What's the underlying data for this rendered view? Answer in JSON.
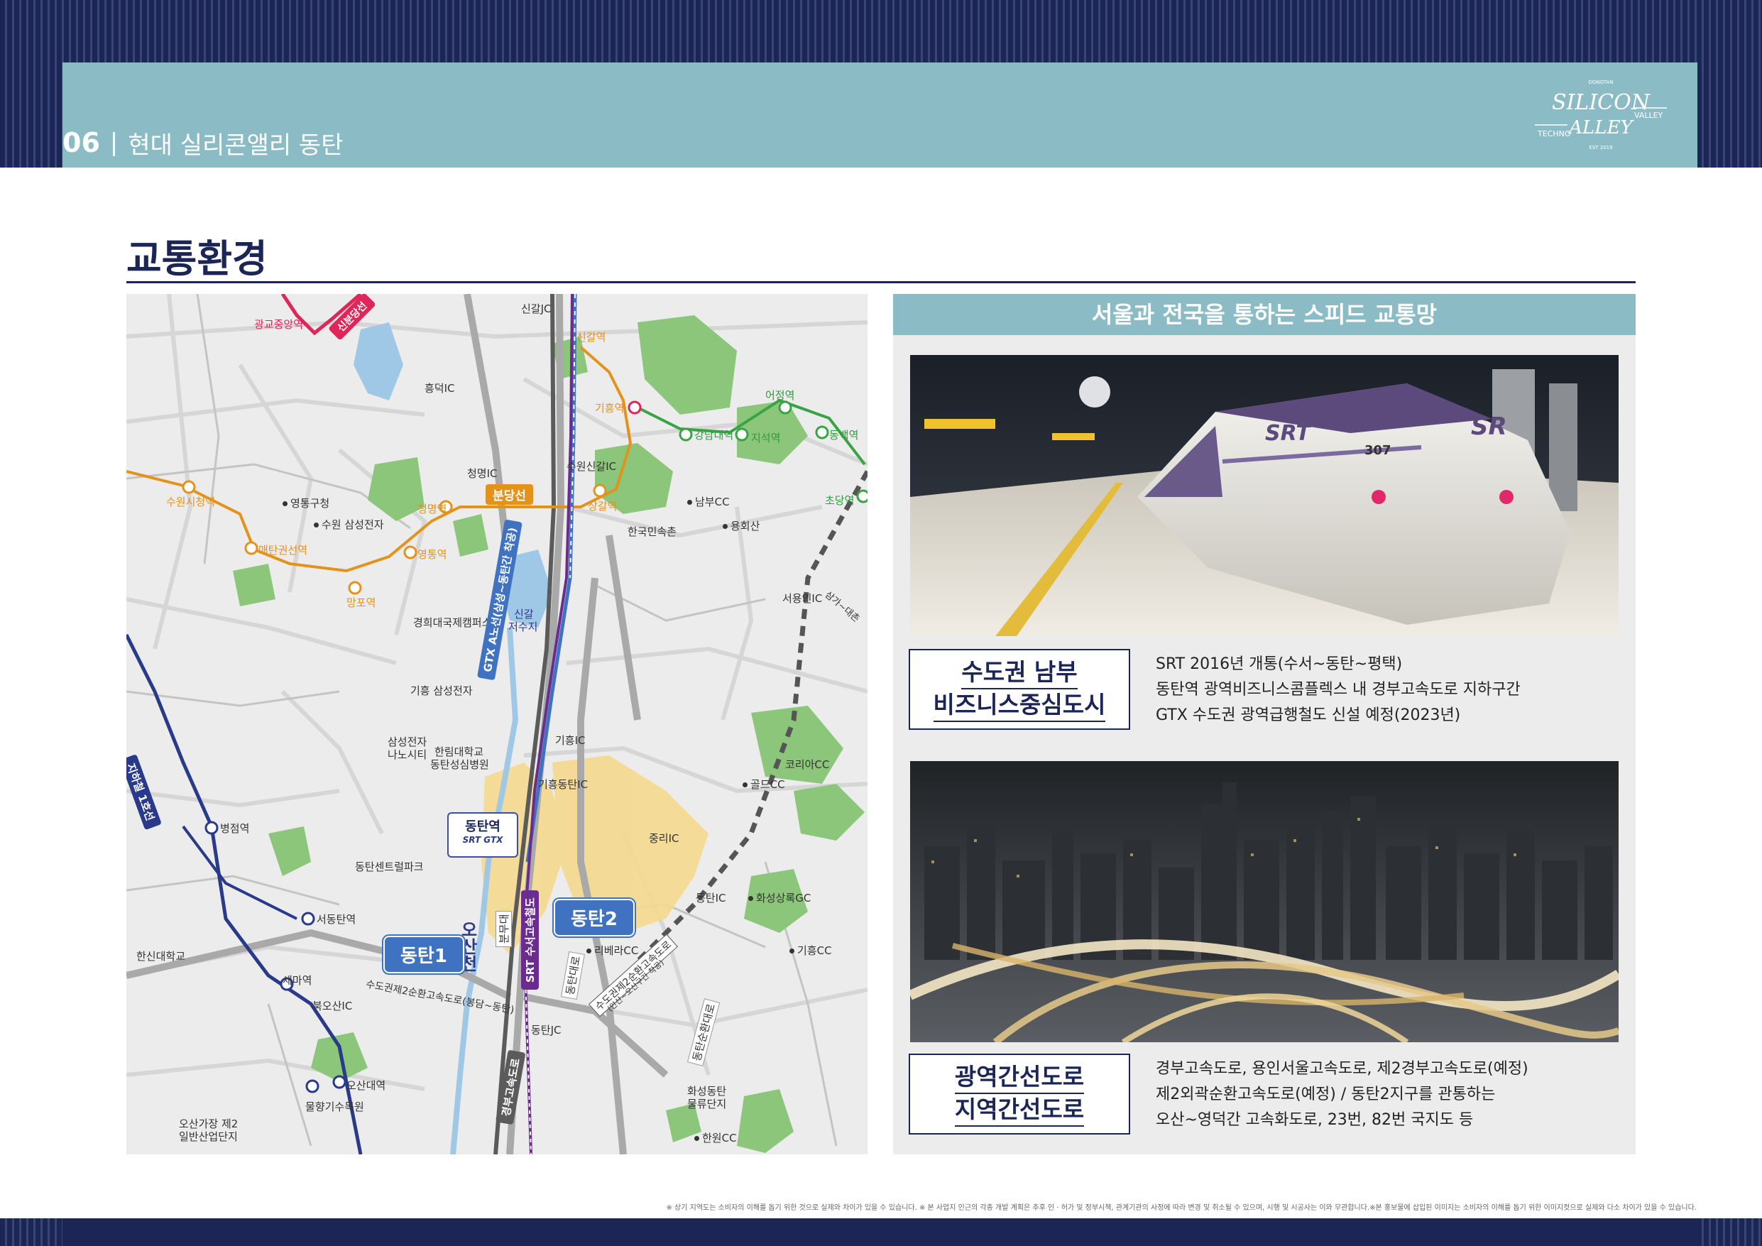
{
  "header": {
    "section_number": "06",
    "divider": "|",
    "section_title": "현대 실리콘앨리 동탄",
    "logo": {
      "top": "DONGTAN",
      "line1": "SILICON",
      "left": "TECHNO",
      "right": "VALLEY",
      "line2": "ALLEY",
      "bottom": "EST 2019"
    }
  },
  "page_title": "교통환경",
  "map": {
    "labels": {
      "gwanggyo_jungang": "광교중앙역",
      "sinbundang": "신분당선",
      "singal_jc": "신갈JC",
      "singal_station": "신갈역",
      "heungdeok_ic": "흥덕IC",
      "giheung_station": "기흥역",
      "eojeong": "어정역",
      "gangnam_univ": "강남대역",
      "jiseok": "지석역",
      "dongbaek": "동백역",
      "suwon_singal_ic": "수원신갈IC",
      "cheongmyeong_ic": "청명IC",
      "bundang_line": "분당선",
      "cheongmyeong_station": "청명역",
      "sanggal": "상갈역",
      "nambu_cc": "남부CC",
      "chodang": "초당역",
      "suwon_city_hall": "수원시청역",
      "yeongtong_gu": "영통구청",
      "suwon_samsung": "수원 삼성전자",
      "korean_folk_village": "한국민속촌",
      "yonghoesan": "용회산",
      "maetan": "매탄권선역",
      "yeongtong": "영통역",
      "mangpo": "망포역",
      "seoyongin_ic": "서용인IC",
      "samga_daechon": "삼가~대촌",
      "kyunghee": "경희대국제캠퍼스",
      "singal_reservoir_1": "신갈",
      "singal_reservoir_2": "저수지",
      "giheung_samsung": "기흥 삼성전자",
      "samsung_nanocity_1": "삼성전자",
      "samsung_nanocity_2": "나노시티",
      "hallym_1": "한림대학교",
      "hallym_2": "동탄성심병원",
      "giheung_ic": "기흥IC",
      "giheung_dongtan_ic": "기흥동탄IC",
      "golf_cc": "골드CC",
      "korea_cc": "코리아CC",
      "jungni_ic": "중리IC",
      "byeongjeom": "병점역",
      "dongtan_central_park": "동탄센트럴파크",
      "dongtan_station": "동탄역",
      "srt_gtx": "SRT GTX",
      "dongtan_ic": "동탄IC",
      "hwaseong_sangrok_gc": "화성상록GC",
      "seodongtan": "서동탄역",
      "dongtan2": "동탄2",
      "dongtan1": "동탄1",
      "riviera_cc": "리베라CC",
      "giheung_cc": "기흥CC",
      "hanshin_univ": "한신대학교",
      "sema": "세마역",
      "buk_osan_ic": "북오산IC",
      "capital_ring2": "수도권제2순환고속도로(봉담~동탄)",
      "dongtan_jc": "동탄JC",
      "capital_ring2_b": "수도권제2순환고속도로",
      "capital_ring2_c": "(안산~오산구간 착공)",
      "osan_univ": "오산대역",
      "hwaseong_logistics_1": "화성동탄",
      "hwaseong_logistics_2": "물류단지",
      "mulhyang_park": "물향기수목원",
      "osan_gajang_1": "오산가장 제2",
      "osan_gajang_2": "일반산업단지",
      "hanwon_cc": "한원CC",
      "gtx": "GTX A노선(삼성~동탄간 착공)",
      "srt": "SRT 수서고속철도",
      "line1_subway": "지하철 1호선",
      "osancheon": "오산천",
      "bunmyeongdae": "분무대",
      "gyeongbu": "경부고속도로",
      "dongtan_sunhwan": "동탄순환대로",
      "dongtan_daero": "동탄대로"
    }
  },
  "panel": {
    "heading": "서울과 전국을 통하는 스피드 교통망",
    "block1": {
      "tag_line1": "수도권 남부",
      "tag_line2": "비즈니스중심도시",
      "lines": [
        "SRT 2016년 개통(수서~동탄~평택)",
        "동탄역 광역비즈니스콤플렉스 내 경부고속도로 지하구간",
        "GTX 수도권 광역급행철도 신설 예정(2023년)"
      ]
    },
    "block2": {
      "tag_line1": "광역간선도로",
      "tag_line2": "지역간선도로",
      "lines": [
        "경부고속도로, 용인서울고속도로, 제2경부고속도로(예정)",
        "제2외곽순환고속도로(예정) / 동탄2지구를 관통하는",
        "오산~영덕간 고속화도로, 23번, 82번 국지도 등"
      ]
    },
    "train_marks": {
      "logo": "SRT",
      "number": "307",
      "front": "SR"
    }
  },
  "footnote": "※ 상기 지역도는 소비자의 이해를 돕기 위한 것으로 실제와 차이가 있을 수 있습니다. ※ 본 사업지 인근의 각종 개발 계획은 추후 인 · 허가 및 정부시책, 관계기관의 사정에 따라 변경 및 취소될 수 있으며, 시행 및 시공사는 이와 무관합니다.※본 홍보물에 삽입된 이미지는 소비자의 이해를 돕기 위한 이미지컷으로 실제와 다소 차이가 있을 수 있습니다.",
  "colors": {
    "navy": "#1b2556",
    "banner": "#8bbcc6",
    "bundang": "#e3921c",
    "gtx": "#3f72c1",
    "srt": "#6a2c8e",
    "sinbundang": "#e02659",
    "line1": "#2a3a8a",
    "green_line": "#3aa345"
  }
}
